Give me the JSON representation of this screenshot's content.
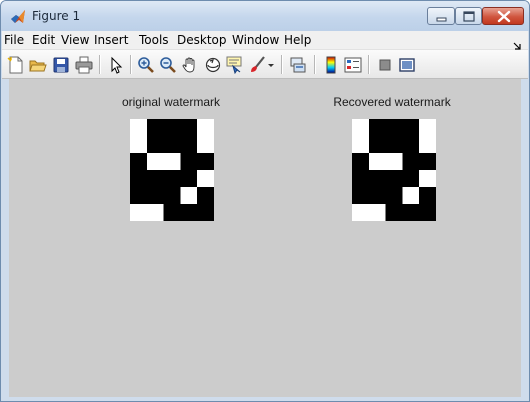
{
  "window": {
    "title": "Figure 1",
    "controls": [
      "minimize",
      "maximize",
      "close"
    ]
  },
  "menubar": {
    "items": [
      "File",
      "Edit",
      "View",
      "Insert",
      "Tools",
      "Desktop",
      "Window",
      "Help"
    ]
  },
  "toolbar": {
    "icons": [
      "new-figure-icon",
      "open-file-icon",
      "save-figure-icon",
      "print-figure-icon",
      "edit-plot-pointer-icon",
      "zoom-in-icon",
      "zoom-out-icon",
      "pan-hand-icon",
      "rotate-3d-icon",
      "data-cursor-icon",
      "brush-icon",
      "brush-dropdown-icon",
      "link-plot-icon",
      "insert-colorbar-icon",
      "insert-legend-icon",
      "hide-plot-tools-icon",
      "show-plot-tools-icon"
    ]
  },
  "figure": {
    "background": "#cccccc",
    "axes": [
      {
        "title": "original watermark",
        "image": [
          [
            1,
            0,
            0,
            0,
            1
          ],
          [
            1,
            0,
            0,
            0,
            1
          ],
          [
            0,
            1,
            1,
            0,
            0
          ],
          [
            0,
            0,
            0,
            0,
            1
          ],
          [
            0,
            0,
            0,
            1,
            0
          ],
          [
            1,
            1,
            0,
            0,
            0
          ]
        ]
      },
      {
        "title": "Recovered watermark",
        "image": [
          [
            1,
            0,
            0,
            0,
            1
          ],
          [
            1,
            0,
            0,
            0,
            1
          ],
          [
            0,
            1,
            1,
            0,
            0
          ],
          [
            0,
            0,
            0,
            0,
            1
          ],
          [
            0,
            0,
            0,
            1,
            0
          ],
          [
            1,
            1,
            0,
            0,
            0
          ]
        ]
      }
    ],
    "colormap": {
      "0": "#000000",
      "1": "#ffffff"
    }
  }
}
